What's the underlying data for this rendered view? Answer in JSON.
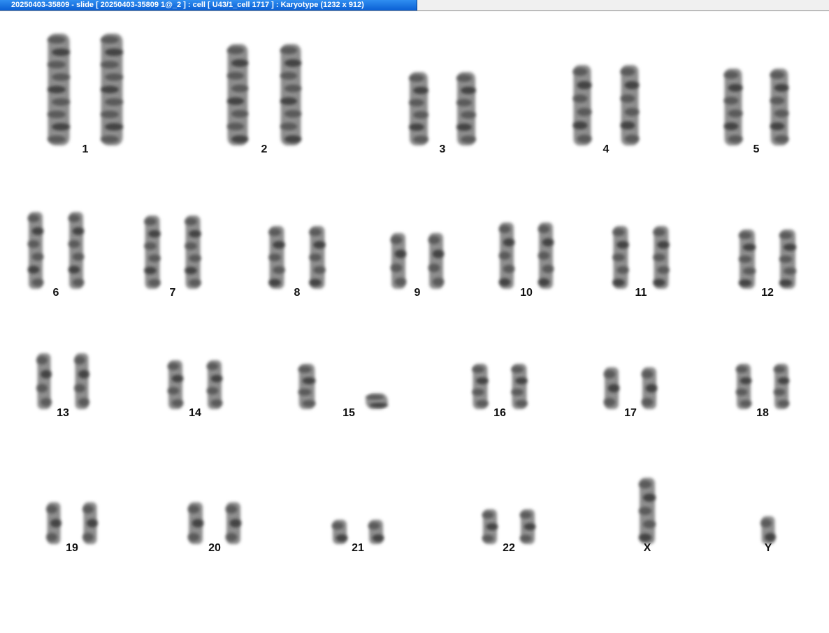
{
  "window": {
    "title": "20250403-35809 - slide [ 20250403-35809 1@_2 ] : cell [ U43/1_cell 1717 ] : Karyotype  (1232 x 912)"
  },
  "karyotype": {
    "chromosomes": [
      {
        "label": "1"
      },
      {
        "label": "2"
      },
      {
        "label": "3"
      },
      {
        "label": "4"
      },
      {
        "label": "5"
      },
      {
        "label": "6"
      },
      {
        "label": "7"
      },
      {
        "label": "8"
      },
      {
        "label": "9"
      },
      {
        "label": "10"
      },
      {
        "label": "11"
      },
      {
        "label": "12"
      },
      {
        "label": "13"
      },
      {
        "label": "14"
      },
      {
        "label": "15"
      },
      {
        "label": "16"
      },
      {
        "label": "17"
      },
      {
        "label": "18"
      },
      {
        "label": "19"
      },
      {
        "label": "20"
      },
      {
        "label": "21"
      },
      {
        "label": "22"
      },
      {
        "label": "X"
      },
      {
        "label": "Y"
      }
    ]
  }
}
